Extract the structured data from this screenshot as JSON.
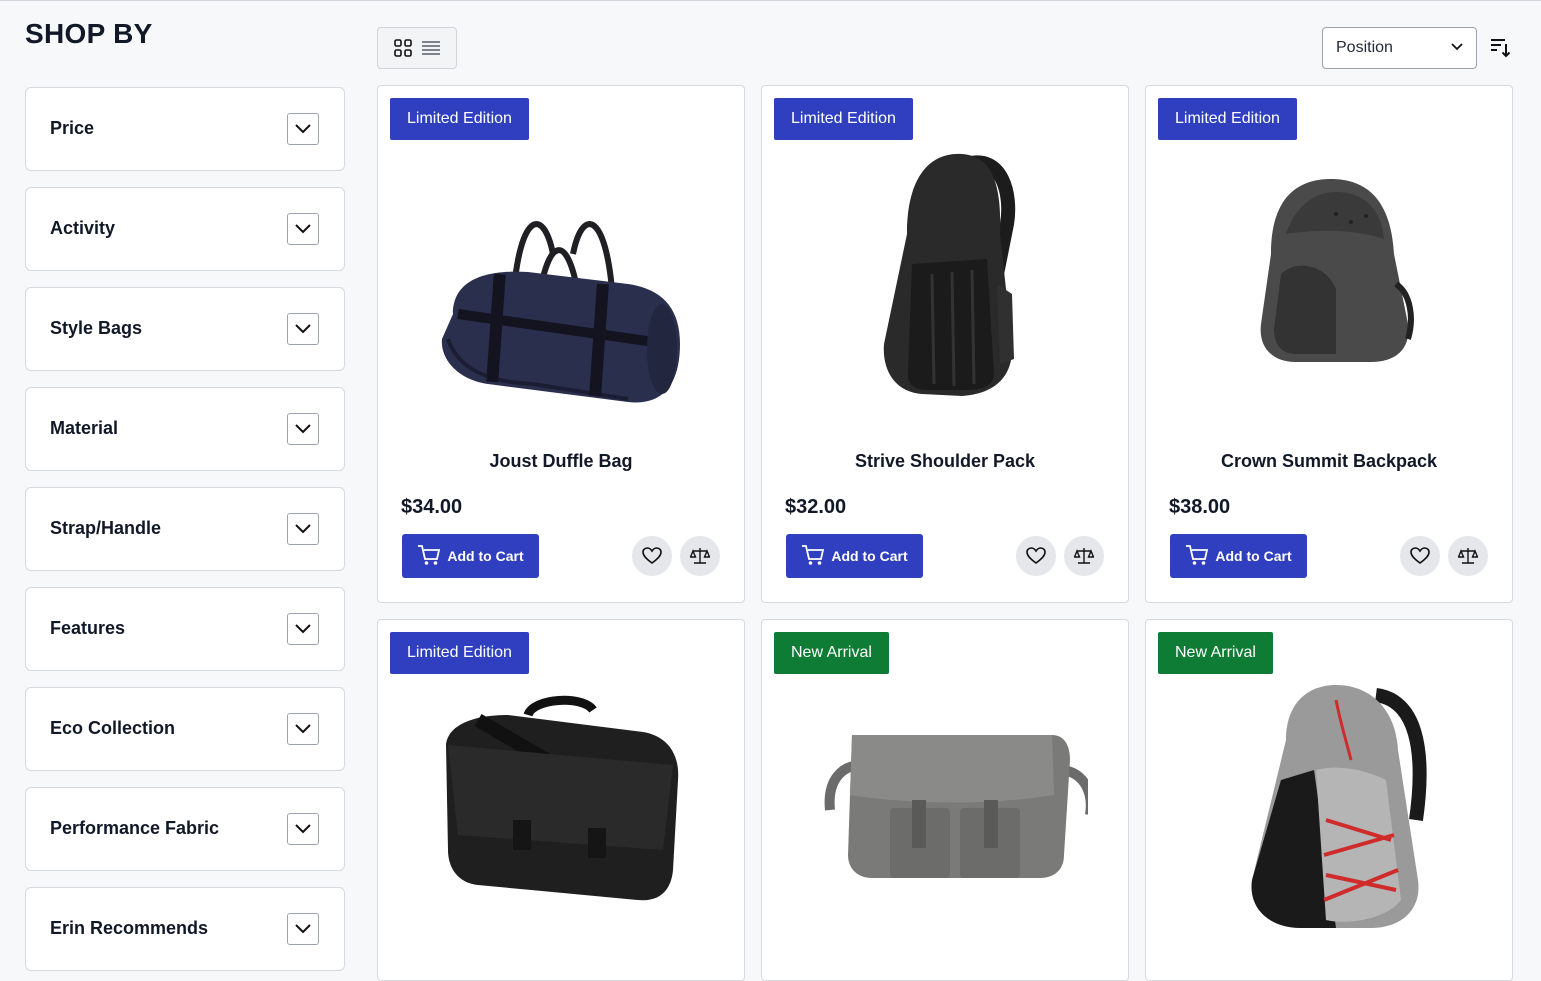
{
  "sidebar": {
    "title": "SHOP BY",
    "filters": [
      {
        "label": "Price"
      },
      {
        "label": "Activity"
      },
      {
        "label": "Style Bags"
      },
      {
        "label": "Material"
      },
      {
        "label": "Strap/Handle"
      },
      {
        "label": "Features"
      },
      {
        "label": "Eco Collection"
      },
      {
        "label": "Performance Fabric"
      },
      {
        "label": "Erin Recommends"
      }
    ]
  },
  "toolbar": {
    "view_modes": [
      "grid-icon",
      "list-icon"
    ],
    "sort": {
      "selected": "Position"
    },
    "sort_direction_icon": "sort-descending-icon"
  },
  "products": [
    {
      "badge": "Limited Edition",
      "badge_color": "#2f3fbf",
      "name": "Joust Duffle Bag",
      "price": "$34.00",
      "add_to_cart": "Add to Cart",
      "image": "duffle-bag"
    },
    {
      "badge": "Limited Edition",
      "badge_color": "#2f3fbf",
      "name": "Strive Shoulder Pack",
      "price": "$32.00",
      "add_to_cart": "Add to Cart",
      "image": "shoulder-pack"
    },
    {
      "badge": "Limited Edition",
      "badge_color": "#2f3fbf",
      "name": "Crown Summit Backpack",
      "price": "$38.00",
      "add_to_cart": "Add to Cart",
      "image": "summit-backpack"
    },
    {
      "badge": "Limited Edition",
      "badge_color": "#2f3fbf",
      "image": "messenger-bag"
    },
    {
      "badge": "New Arrival",
      "badge_color": "#0e7c34",
      "image": "gray-messenger"
    },
    {
      "badge": "New Arrival",
      "badge_color": "#0e7c34",
      "image": "gray-red-backpack"
    }
  ],
  "colors": {
    "primary": "#2f3fbf",
    "new_arrival": "#0e7c34"
  }
}
